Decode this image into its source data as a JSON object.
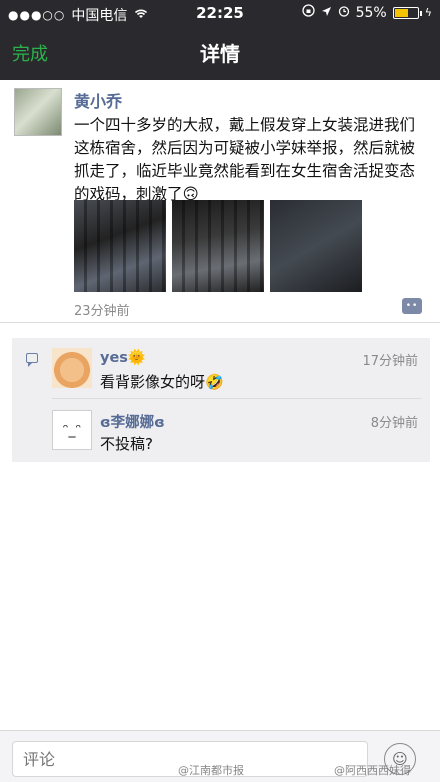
{
  "status_bar": {
    "signal": "●●●○○",
    "carrier": "中国电信",
    "time": "22:25",
    "battery": "55%",
    "battery_level": 0.55
  },
  "nav": {
    "done_label": "完成",
    "title": "详情"
  },
  "post": {
    "author": "黄小乔",
    "text": "一个四十多岁的大叔，戴上假发穿上女装混进我们这栋宿舍，然后因为可疑被小学妹举报，然后就被抓走了，临近毕业竟然能看到在女生宿舍活捉变态的戏码，刺激了🙃",
    "time": "23分钟前"
  },
  "comments": [
    {
      "name": "yes🌞",
      "text": "看背影像女的呀🤣",
      "time": "17分钟前"
    },
    {
      "name": "ɞ李娜娜ɞ",
      "text": "不投稿?",
      "time": "8分钟前"
    }
  ],
  "input": {
    "placeholder": "评论"
  },
  "watermarks": [
    "@江南都市报",
    "@阿西西西妹得"
  ]
}
